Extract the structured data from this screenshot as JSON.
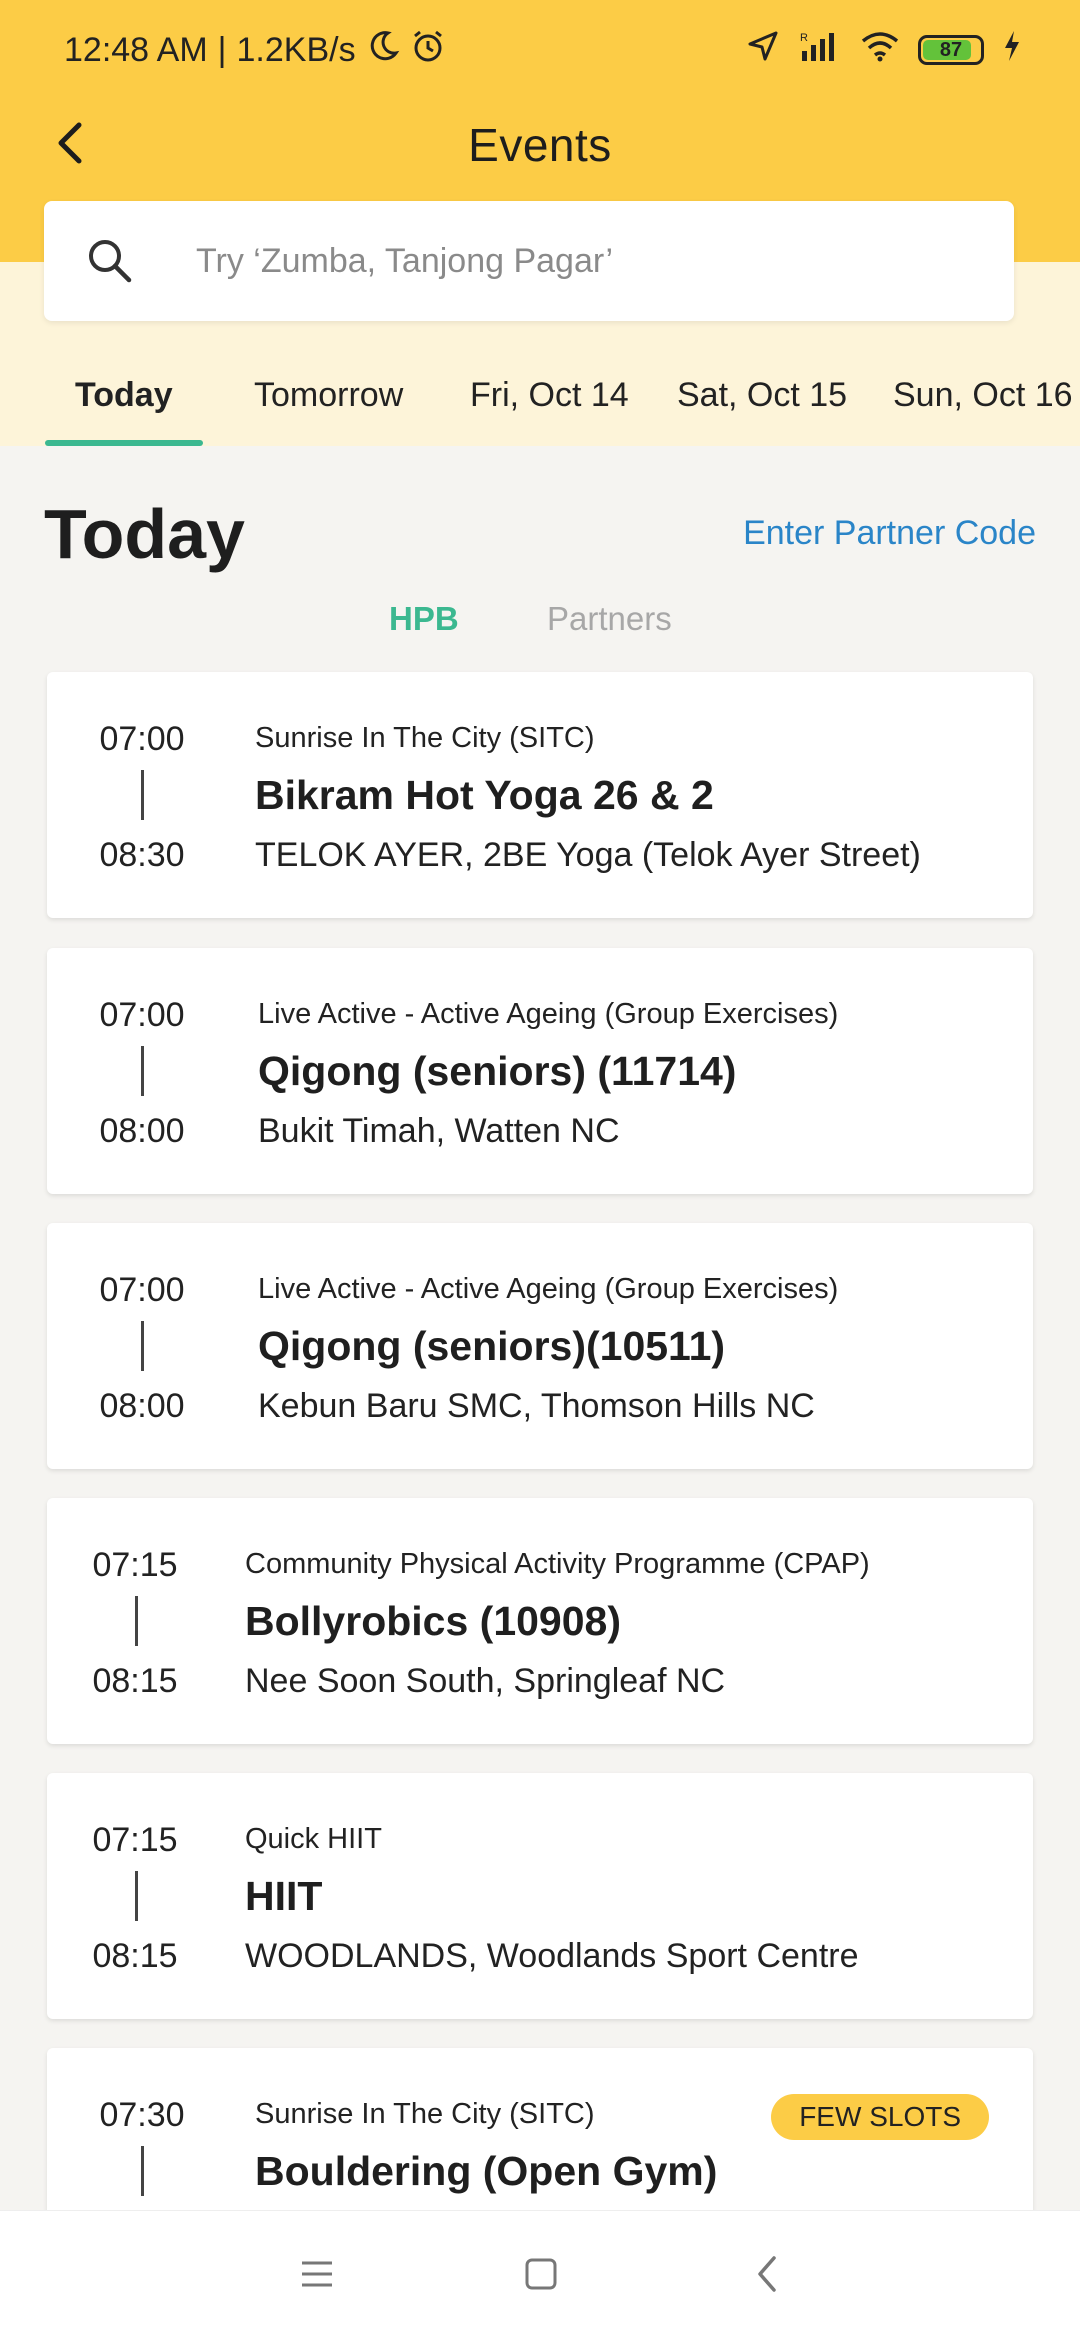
{
  "status_bar": {
    "time": "12:48 AM",
    "separator": "|",
    "network_speed": "1.2KB/s",
    "battery_level": "87",
    "icons": [
      "moon-icon",
      "alarm-icon",
      "location-arrow-icon",
      "signal-icon",
      "wifi-icon",
      "battery-icon",
      "charging-icon"
    ]
  },
  "header": {
    "title": "Events",
    "back_icon": "back-arrow-icon"
  },
  "search": {
    "placeholder": "Try ‘Zumba, Tanjong Pagar’",
    "value": ""
  },
  "date_tabs": [
    {
      "label": "Today",
      "active": true
    },
    {
      "label": "Tomorrow",
      "active": false
    },
    {
      "label": "Fri, Oct 14",
      "active": false
    },
    {
      "label": "Sat, Oct 15",
      "active": false
    },
    {
      "label": "Sun, Oct 16",
      "active": false
    }
  ],
  "section": {
    "title": "Today",
    "partner_code_link": "Enter Partner Code"
  },
  "sub_tabs": [
    {
      "label": "HPB",
      "active": true
    },
    {
      "label": "Partners",
      "active": false
    }
  ],
  "events": [
    {
      "start": "07:00",
      "end": "08:30",
      "org": "Sunrise In The City (SITC)",
      "title": "Bikram Hot Yoga 26 & 2",
      "location": "TELOK AYER, 2BE Yoga (Telok Ayer Street)",
      "badge": ""
    },
    {
      "start": "07:00",
      "end": "08:00",
      "org": "Live Active - Active Ageing (Group Exercises)",
      "title": "Qigong (seniors) (11714)",
      "location": "Bukit Timah, Watten NC",
      "badge": ""
    },
    {
      "start": "07:00",
      "end": "08:00",
      "org": "Live Active - Active Ageing (Group Exercises)",
      "title": "Qigong (seniors)(10511)",
      "location": "Kebun Baru SMC, Thomson Hills NC",
      "badge": ""
    },
    {
      "start": "07:15",
      "end": "08:15",
      "org": "Community Physical Activity Programme (CPAP)",
      "title": "Bollyrobics (10908)",
      "location": "Nee Soon South, Springleaf NC",
      "badge": ""
    },
    {
      "start": "07:15",
      "end": "08:15",
      "org": "Quick HIIT",
      "title": "HIIT",
      "location": "WOODLANDS, Woodlands Sport Centre",
      "badge": ""
    },
    {
      "start": "07:30",
      "end": "",
      "org": "Sunrise In The City (SITC)",
      "title": "Bouldering (Open Gym)",
      "location": "",
      "badge": "FEW SLOTS"
    }
  ],
  "colors": {
    "header_yellow": "#fccc46",
    "cream": "#fdf4d9",
    "accent_green": "#3bb890",
    "link_blue": "#2a85c8",
    "badge_yellow": "#fccc46"
  },
  "bottom_nav": {
    "icons": [
      "menu-icon",
      "home-square-icon",
      "back-triangle-icon"
    ]
  }
}
